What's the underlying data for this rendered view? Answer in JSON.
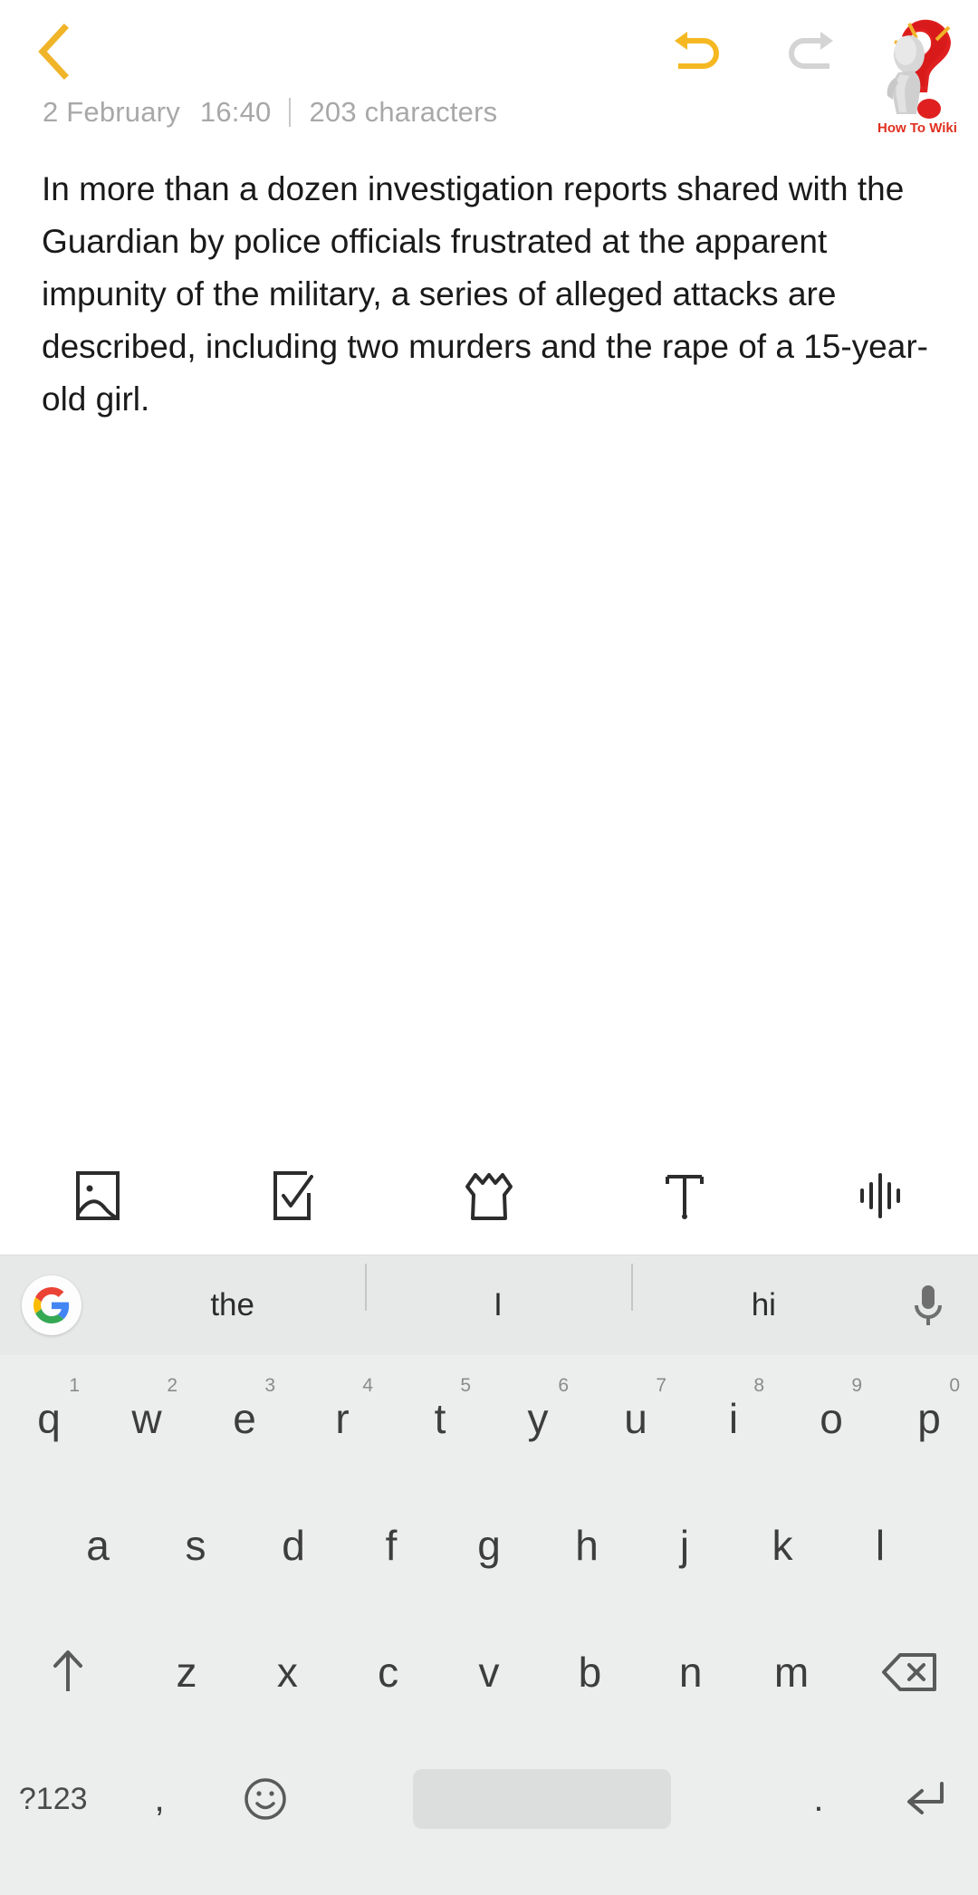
{
  "app": {
    "screen_name": "note-editor",
    "background": "#ffffff"
  },
  "topbar": {
    "back_label": "‹",
    "back_icon": "chevron-left-icon",
    "back_color": "#f0b429",
    "undo_icon": "undo-arrow-icon",
    "undo_color": "#f5b822",
    "redo_icon": "redo-arrow-icon",
    "redo_color": "#d4d4d4"
  },
  "watermark": {
    "label": "How To Wiki",
    "color": "#e03020",
    "icon": "question-mark-figure-logo"
  },
  "meta": {
    "date": "2 February",
    "time": "16:40",
    "separator": "|",
    "character_count": "203 characters"
  },
  "note": {
    "text": "In more than a dozen investigation reports shared with the Guardian by police officials frustrated at the apparent impunity of the military, a series of alleged attacks are described, including two murders and the rape of a 15-year-old girl."
  },
  "attachment_toolbar": {
    "items": [
      {
        "name": "insert-image",
        "icon": "image-icon"
      },
      {
        "name": "insert-checklist",
        "icon": "checklist-icon"
      },
      {
        "name": "insert-drawing",
        "icon": "drawing-shirt-icon"
      },
      {
        "name": "text-format",
        "icon": "text-format-icon"
      },
      {
        "name": "voice-recording",
        "icon": "voice-waveform-icon"
      }
    ]
  },
  "keyboard": {
    "background": "#eceded",
    "suggestion_bar": {
      "background": "#e7e8e8",
      "google_logo": "google-g-icon",
      "mic_icon": "microphone-icon",
      "suggestions": [
        "the",
        "I",
        "hi"
      ]
    },
    "rows": [
      {
        "name": "row-qwerty",
        "keys": [
          {
            "label": "q",
            "num": "1"
          },
          {
            "label": "w",
            "num": "2"
          },
          {
            "label": "e",
            "num": "3"
          },
          {
            "label": "r",
            "num": "4"
          },
          {
            "label": "t",
            "num": "5"
          },
          {
            "label": "y",
            "num": "6"
          },
          {
            "label": "u",
            "num": "7"
          },
          {
            "label": "i",
            "num": "8"
          },
          {
            "label": "o",
            "num": "9"
          },
          {
            "label": "p",
            "num": "0"
          }
        ]
      },
      {
        "name": "row-asdf",
        "keys": [
          {
            "label": "a"
          },
          {
            "label": "s"
          },
          {
            "label": "d"
          },
          {
            "label": "f"
          },
          {
            "label": "g"
          },
          {
            "label": "h"
          },
          {
            "label": "j"
          },
          {
            "label": "k"
          },
          {
            "label": "l"
          }
        ]
      },
      {
        "name": "row-zxcv",
        "keys": [
          {
            "label": "",
            "icon": "shift-arrow-icon",
            "name": "shift-key"
          },
          {
            "label": "z"
          },
          {
            "label": "x"
          },
          {
            "label": "c"
          },
          {
            "label": "v"
          },
          {
            "label": "b"
          },
          {
            "label": "n"
          },
          {
            "label": "m"
          },
          {
            "label": "",
            "icon": "backspace-icon",
            "name": "backspace-key"
          }
        ]
      },
      {
        "name": "row-bottom",
        "keys": [
          {
            "label": "?123",
            "name": "symbols-key"
          },
          {
            "label": ",",
            "name": "comma-key"
          },
          {
            "label": "",
            "icon": "emoji-smiley-icon",
            "name": "emoji-key"
          },
          {
            "label": "",
            "name": "space-key"
          },
          {
            "label": ".",
            "name": "period-key"
          },
          {
            "label": "",
            "icon": "enter-arrow-icon",
            "name": "enter-key"
          }
        ]
      }
    ]
  }
}
